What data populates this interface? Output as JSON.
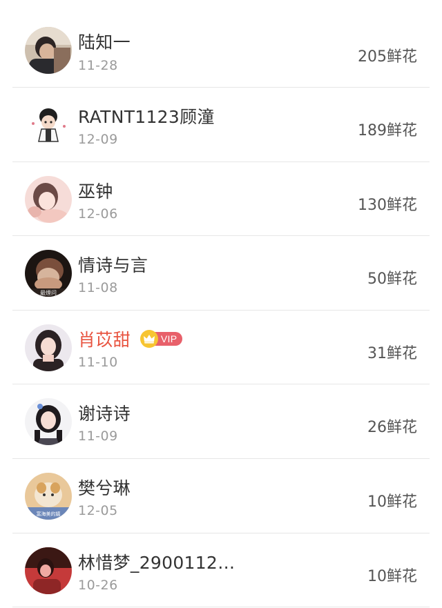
{
  "rows": [
    {
      "name": "陆知一",
      "date": "11-28",
      "amount": "205鲜花",
      "avatar_colors": [
        "#2d2524",
        "#8a6e5c",
        "#d8c6b3"
      ]
    },
    {
      "name": "RATNT1123顾潼",
      "date": "12-09",
      "amount": "189鲜花",
      "avatar_colors": [
        "#ffffff",
        "#222222",
        "#f1d5c3"
      ]
    },
    {
      "name": "巫钟",
      "date": "12-06",
      "amount": "130鲜花",
      "avatar_colors": [
        "#f3d2cd",
        "#6b4a46",
        "#fbe6e2"
      ]
    },
    {
      "name": "情诗与言",
      "date": "11-08",
      "amount": "50鲜花",
      "avatar_colors": [
        "#1c1512",
        "#a4705a",
        "#d6b49c"
      ],
      "avatar_caption": "最煙问"
    },
    {
      "name": "肖苡甜",
      "date": "11-10",
      "amount": "31鲜花",
      "vip": true,
      "vip_label": "VIP",
      "avatar_colors": [
        "#e9e4ea",
        "#2b2224",
        "#f3d7cf"
      ]
    },
    {
      "name": "谢诗诗",
      "date": "11-09",
      "amount": "26鲜花",
      "avatar_colors": [
        "#f1f1f3",
        "#1e1a1d",
        "#f6dcd3"
      ]
    },
    {
      "name": "樊兮琳",
      "date": "12-05",
      "amount": "10鲜花",
      "avatar_colors": [
        "#d8a35d",
        "#f3e6d2",
        "#6b86b8"
      ],
      "avatar_caption": "富海美的嬉"
    },
    {
      "name": "林惜梦_2900112…",
      "date": "10-26",
      "amount": "10鲜花",
      "avatar_colors": [
        "#3b1814",
        "#c53a3a",
        "#f0a9a2"
      ]
    }
  ],
  "colors": {
    "name": "#333333",
    "vip_name": "#e8533f",
    "date": "#9a9a9a",
    "amount": "#555555",
    "divider": "#e6e6e6",
    "vip_crown": "#f7c531",
    "vip_badge": "#e8606a"
  }
}
